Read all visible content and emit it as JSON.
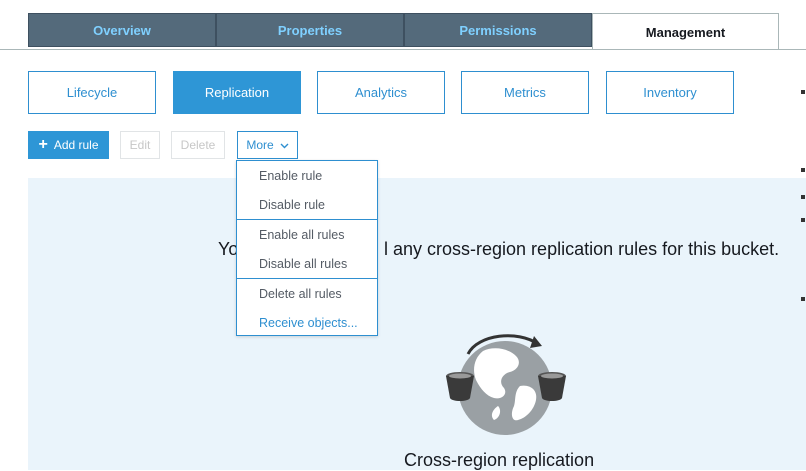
{
  "top_tabs": [
    "Overview",
    "Properties",
    "Permissions",
    "Management"
  ],
  "active_top_tab": "Management",
  "sub_tabs": [
    "Lifecycle",
    "Replication",
    "Analytics",
    "Metrics",
    "Inventory"
  ],
  "active_sub_tab": "Replication",
  "toolbar": {
    "add_rule": "Add rule",
    "edit": "Edit",
    "delete": "Delete",
    "more": "More"
  },
  "dropdown": {
    "items": [
      "Enable rule",
      "Disable rule",
      "Enable all rules",
      "Disable all rules",
      "Delete all rules",
      "Receive objects..."
    ]
  },
  "empty_state": {
    "message_lead": "Yo",
    "message_rest": "l any cross-region replication rules for this bucket.",
    "title": "Cross-region replication"
  },
  "colors": {
    "primary": "#2e96d6",
    "tab_bg": "#546a7b",
    "tab_text": "#7fd0ff",
    "panel_bg": "#eaf4fb"
  },
  "icons": {
    "add": "plus-icon",
    "more": "chevron-down-icon",
    "illustration": "globe-buckets-icon"
  }
}
